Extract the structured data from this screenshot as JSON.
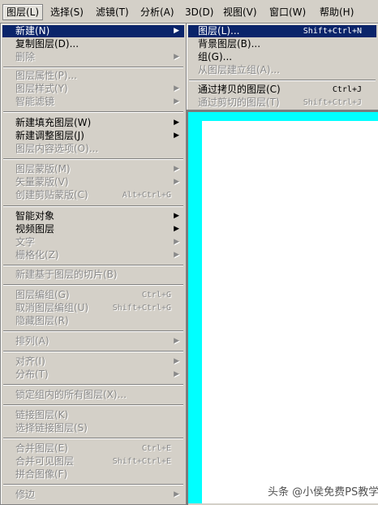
{
  "menubar": {
    "items": [
      "图层(L)",
      "选择(S)",
      "滤镜(T)",
      "分析(A)",
      "3D(D)",
      "视图(V)",
      "窗口(W)",
      "帮助(H)"
    ]
  },
  "main_menu": {
    "items": [
      {
        "label": "新建(N)",
        "shortcut": "",
        "arrow": "▶"
      },
      {
        "label": "复制图层(D)...",
        "shortcut": "",
        "arrow": ""
      },
      {
        "label": "删除",
        "shortcut": "",
        "arrow": "▶"
      },
      {
        "label": "图层属性(P)...",
        "shortcut": "",
        "arrow": ""
      },
      {
        "label": "图层样式(Y)",
        "shortcut": "",
        "arrow": "▶"
      },
      {
        "label": "智能滤镜",
        "shortcut": "",
        "arrow": "▶"
      },
      {
        "label": "新建填充图层(W)",
        "shortcut": "",
        "arrow": "▶"
      },
      {
        "label": "新建调整图层(J)",
        "shortcut": "",
        "arrow": "▶"
      },
      {
        "label": "图层内容选项(O)...",
        "shortcut": "",
        "arrow": ""
      },
      {
        "label": "图层蒙版(M)",
        "shortcut": "",
        "arrow": "▶"
      },
      {
        "label": "矢量蒙版(V)",
        "shortcut": "",
        "arrow": "▶"
      },
      {
        "label": "创建剪贴蒙版(C)",
        "shortcut": "Alt+Ctrl+G",
        "arrow": ""
      },
      {
        "label": "智能对象",
        "shortcut": "",
        "arrow": "▶"
      },
      {
        "label": "视频图层",
        "shortcut": "",
        "arrow": "▶"
      },
      {
        "label": "文字",
        "shortcut": "",
        "arrow": "▶"
      },
      {
        "label": "栅格化(Z)",
        "shortcut": "",
        "arrow": "▶"
      },
      {
        "label": "新建基于图层的切片(B)",
        "shortcut": "",
        "arrow": ""
      },
      {
        "label": "图层编组(G)",
        "shortcut": "Ctrl+G",
        "arrow": ""
      },
      {
        "label": "取消图层编组(U)",
        "shortcut": "Shift+Ctrl+G",
        "arrow": ""
      },
      {
        "label": "隐藏图层(R)",
        "shortcut": "",
        "arrow": ""
      },
      {
        "label": "排列(A)",
        "shortcut": "",
        "arrow": "▶"
      },
      {
        "label": "对齐(I)",
        "shortcut": "",
        "arrow": "▶"
      },
      {
        "label": "分布(T)",
        "shortcut": "",
        "arrow": "▶"
      },
      {
        "label": "锁定组内的所有图层(X)...",
        "shortcut": "",
        "arrow": ""
      },
      {
        "label": "链接图层(K)",
        "shortcut": "",
        "arrow": ""
      },
      {
        "label": "选择链接图层(S)",
        "shortcut": "",
        "arrow": ""
      },
      {
        "label": "合并图层(E)",
        "shortcut": "Ctrl+E",
        "arrow": ""
      },
      {
        "label": "合并可见图层",
        "shortcut": "Shift+Ctrl+E",
        "arrow": ""
      },
      {
        "label": "拼合图像(F)",
        "shortcut": "",
        "arrow": ""
      },
      {
        "label": "修边",
        "shortcut": "",
        "arrow": "▶"
      }
    ]
  },
  "sub_menu": {
    "items": [
      {
        "label": "图层(L)...",
        "shortcut": "Shift+Ctrl+N"
      },
      {
        "label": "背景图层(B)...",
        "shortcut": ""
      },
      {
        "label": "组(G)...",
        "shortcut": ""
      },
      {
        "label": "从图层建立组(A)...",
        "shortcut": ""
      },
      {
        "label": "通过拷贝的图层(C)",
        "shortcut": "Ctrl+J"
      },
      {
        "label": "通过剪切的图层(T)",
        "shortcut": "Shift+Ctrl+J"
      }
    ]
  },
  "colors": {
    "highlight": "#0a246a",
    "menu_bg": "#d4d0c8",
    "canvas_border": "#00ffff",
    "disabled_text": "#8a8a8a"
  },
  "watermark": "头条 @小侯免费PS教学"
}
